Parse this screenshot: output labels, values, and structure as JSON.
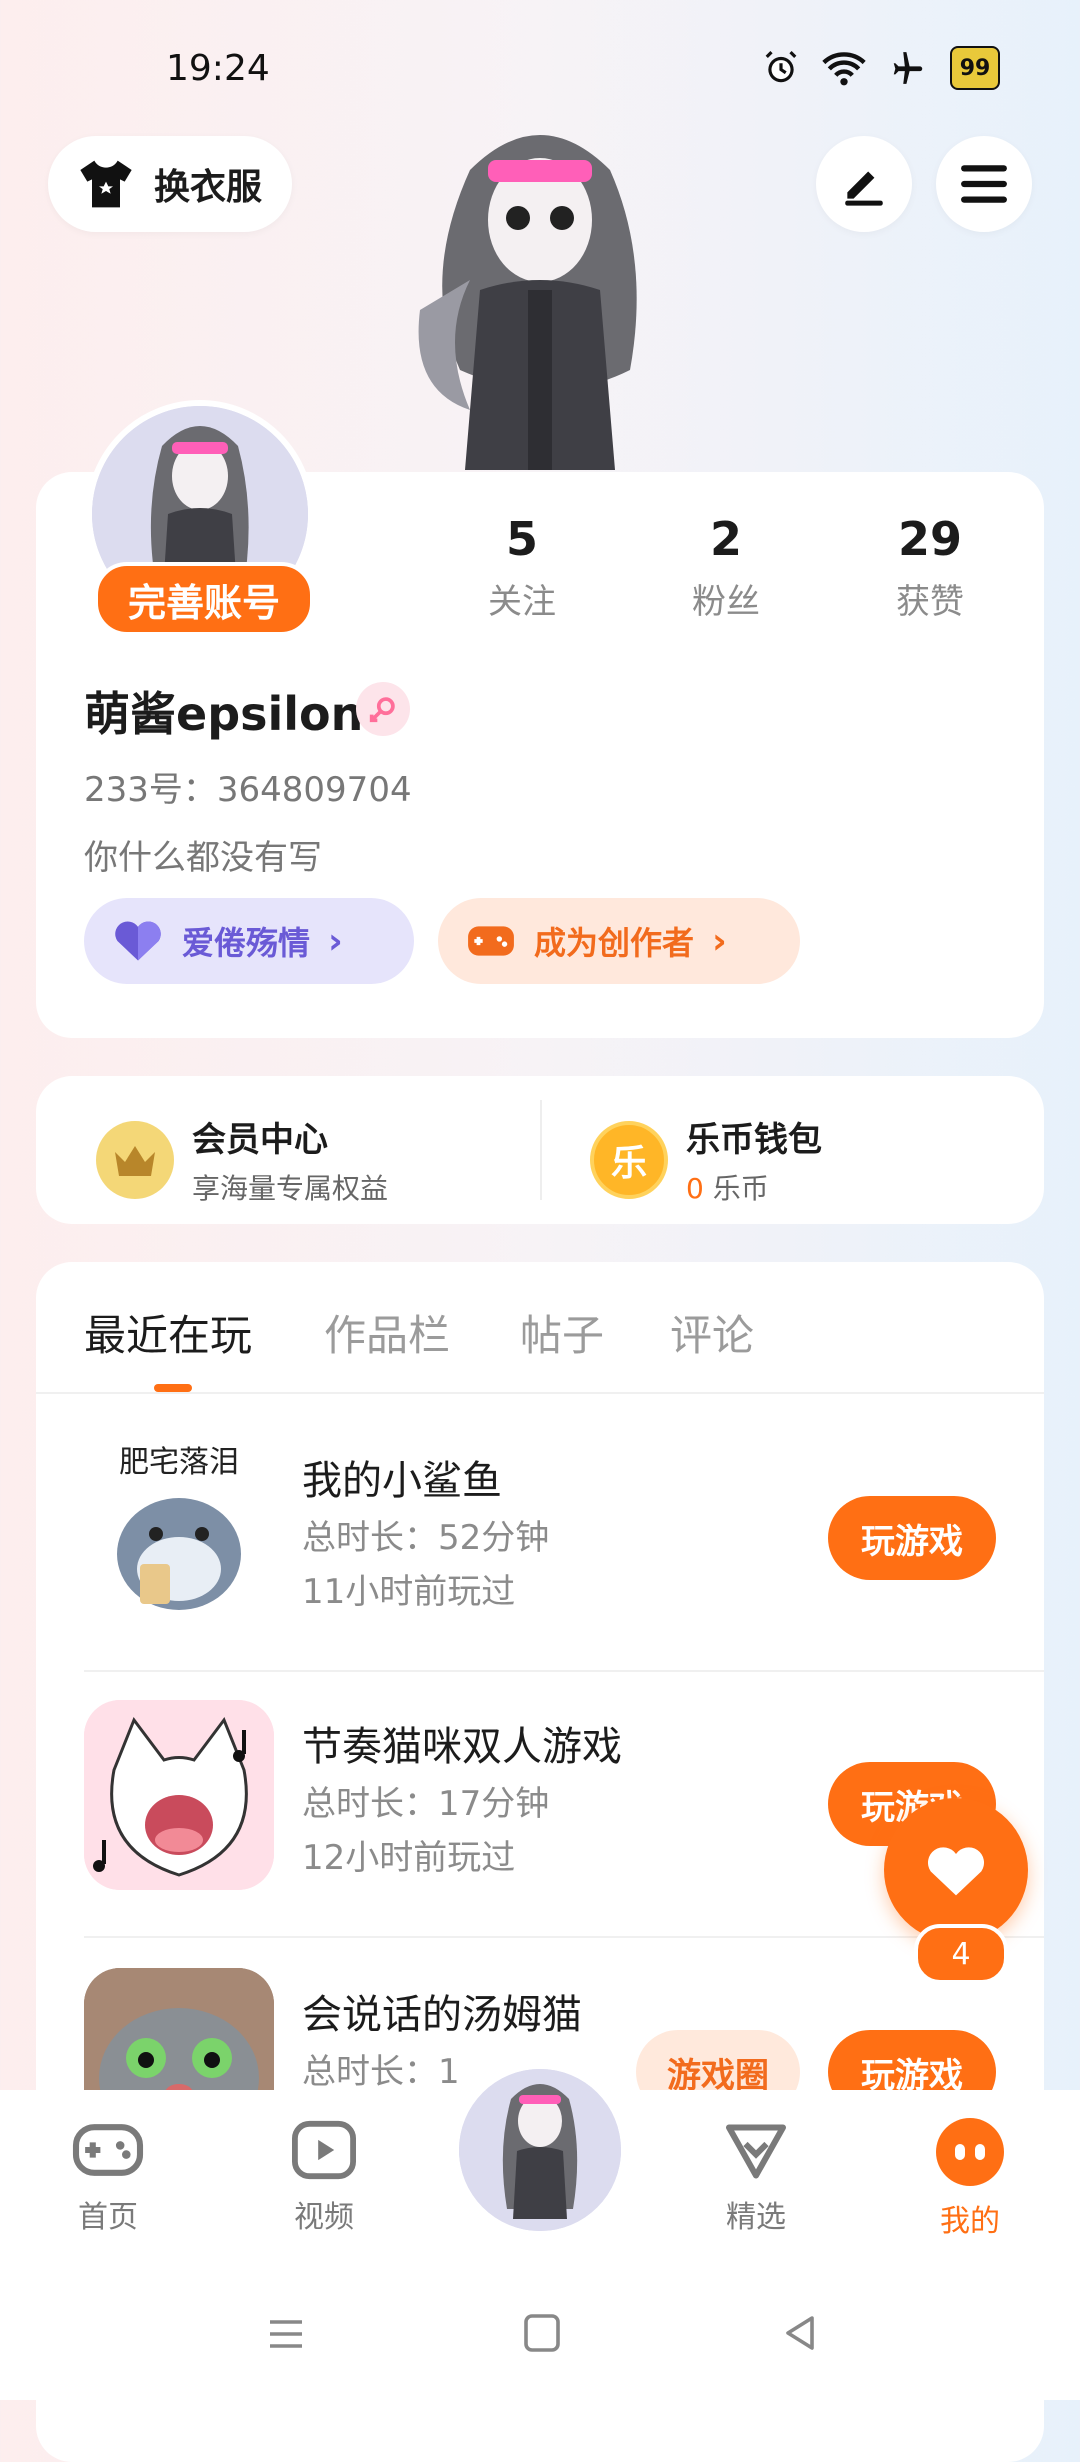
{
  "status_bar": {
    "time": "19:24",
    "battery": "99"
  },
  "top": {
    "dress_label": "换衣服"
  },
  "profile": {
    "complete_label": "完善账号",
    "stats": [
      {
        "value": "5",
        "label": "关注"
      },
      {
        "value": "2",
        "label": "粉丝"
      },
      {
        "value": "29",
        "label": "获赞"
      }
    ],
    "username": "萌酱epsilon",
    "uid": "233号：364809704",
    "bio": "你什么都没有写",
    "love_label": "爱倦殇情",
    "creator_label": "成为创作者"
  },
  "vip": {
    "member_title": "会员中心",
    "member_sub": "享海量专属权益",
    "wallet_title": "乐币钱包",
    "wallet_amount": "0",
    "wallet_unit": "乐币",
    "coin_char": "乐"
  },
  "tabs": [
    "最近在玩",
    "作品栏",
    "帖子",
    "评论"
  ],
  "games": [
    {
      "name": "我的小鲨鱼",
      "duration": "总时长：52分钟",
      "last": "11小时前玩过",
      "play": "玩游戏",
      "icon_text": "肥宅落泪"
    },
    {
      "name": "节奏猫咪双人游戏",
      "duration": "总时长：17分钟",
      "last": "12小时前玩过",
      "play": "玩游戏"
    },
    {
      "name": "会说话的汤姆猫",
      "duration": "总时长：1",
      "circle": "游戏圈",
      "play": "玩游戏"
    }
  ],
  "float_like": {
    "count": "4"
  },
  "nav": {
    "home": "首页",
    "video": "视频",
    "featured": "精选",
    "mine": "我的"
  },
  "colors": {
    "accent": "#ff6f14",
    "purple": "#6a5ad6"
  }
}
